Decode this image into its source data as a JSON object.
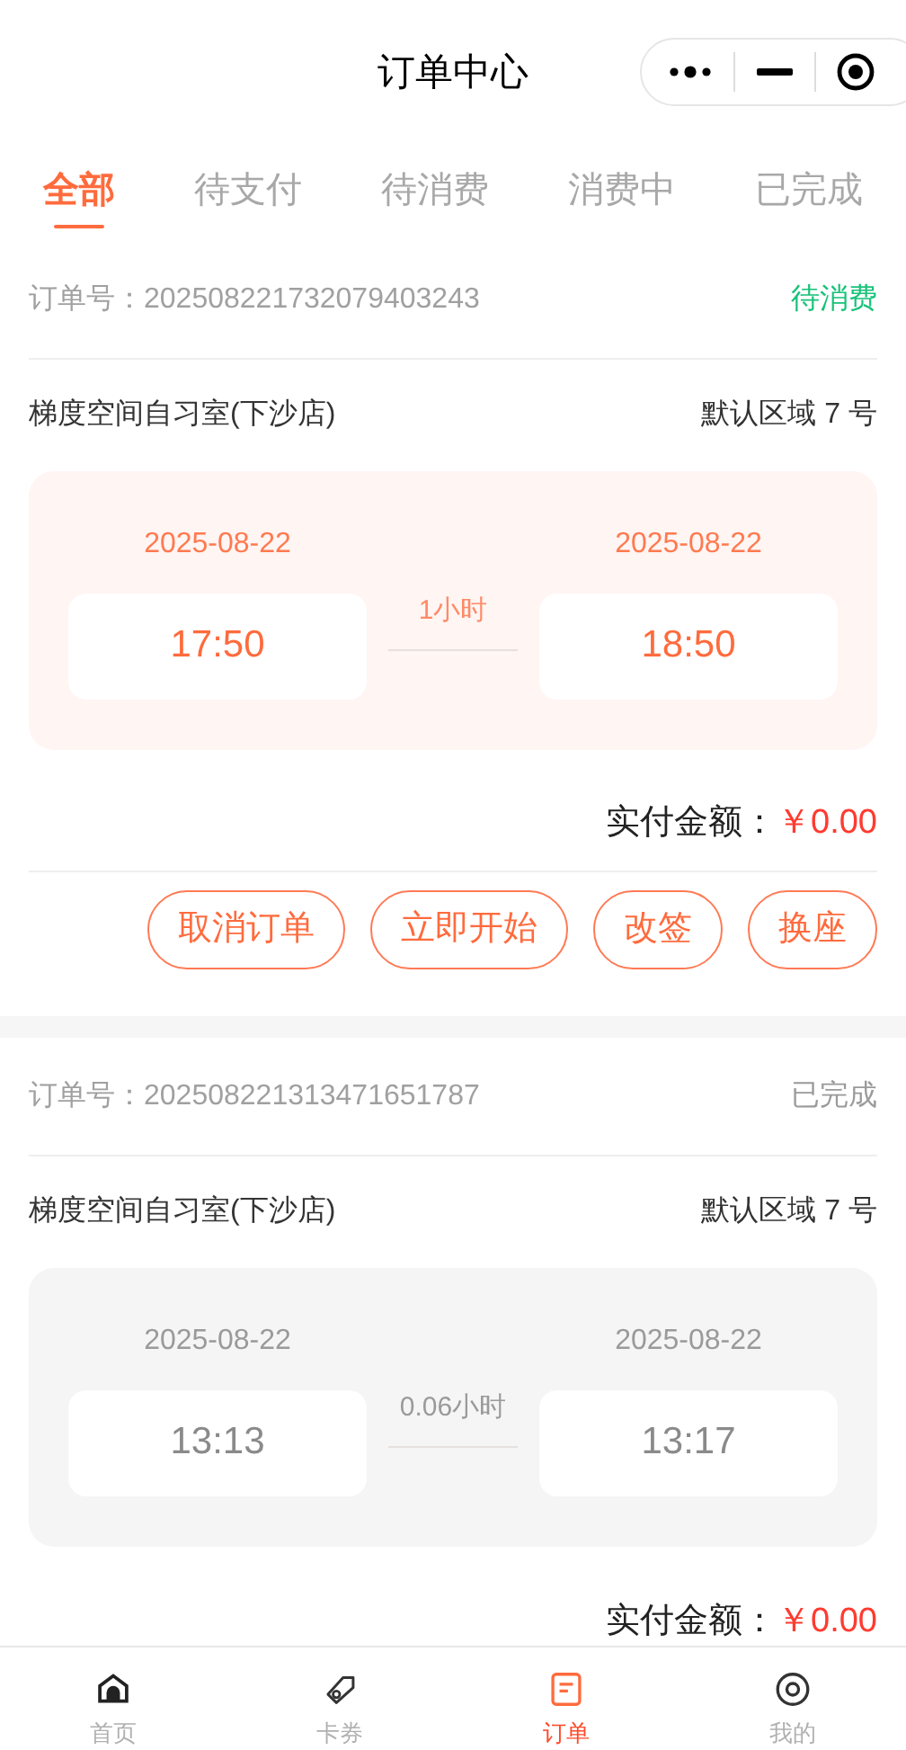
{
  "header": {
    "title": "订单中心"
  },
  "tabs": [
    {
      "label": "全部",
      "selected": true
    },
    {
      "label": "待支付",
      "selected": false
    },
    {
      "label": "待消费",
      "selected": false
    },
    {
      "label": "消费中",
      "selected": false
    },
    {
      "label": "已完成",
      "selected": false
    }
  ],
  "orders": [
    {
      "kind": "active",
      "order_label": "订单号：",
      "order_no": "202508221732079403243",
      "status": "待消费",
      "store": "梯度空间自习室(下沙店)",
      "seat": "默认区域 7 号",
      "start_date": "2025-08-22",
      "start_time": "17:50",
      "duration": "1小时",
      "end_date": "2025-08-22",
      "end_time": "18:50",
      "total_label": "实付金额：",
      "total": "￥0.00",
      "buttons": [
        "取消订单",
        "立即开始",
        "改签",
        "换座"
      ]
    },
    {
      "kind": "done",
      "order_label": "订单号：",
      "order_no": "202508221313471651787",
      "status": "已完成",
      "store": "梯度空间自习室(下沙店)",
      "seat": "默认区域 7 号",
      "start_date": "2025-08-22",
      "start_time": "13:13",
      "duration": "0.06小时",
      "end_date": "2025-08-22",
      "end_time": "13:17",
      "total_label": "实付金额：",
      "total": "￥0.00"
    }
  ],
  "nav": [
    {
      "label": "首页",
      "selected": false
    },
    {
      "label": "卡券",
      "selected": false
    },
    {
      "label": "订单",
      "selected": true
    },
    {
      "label": "我的",
      "selected": false
    }
  ]
}
